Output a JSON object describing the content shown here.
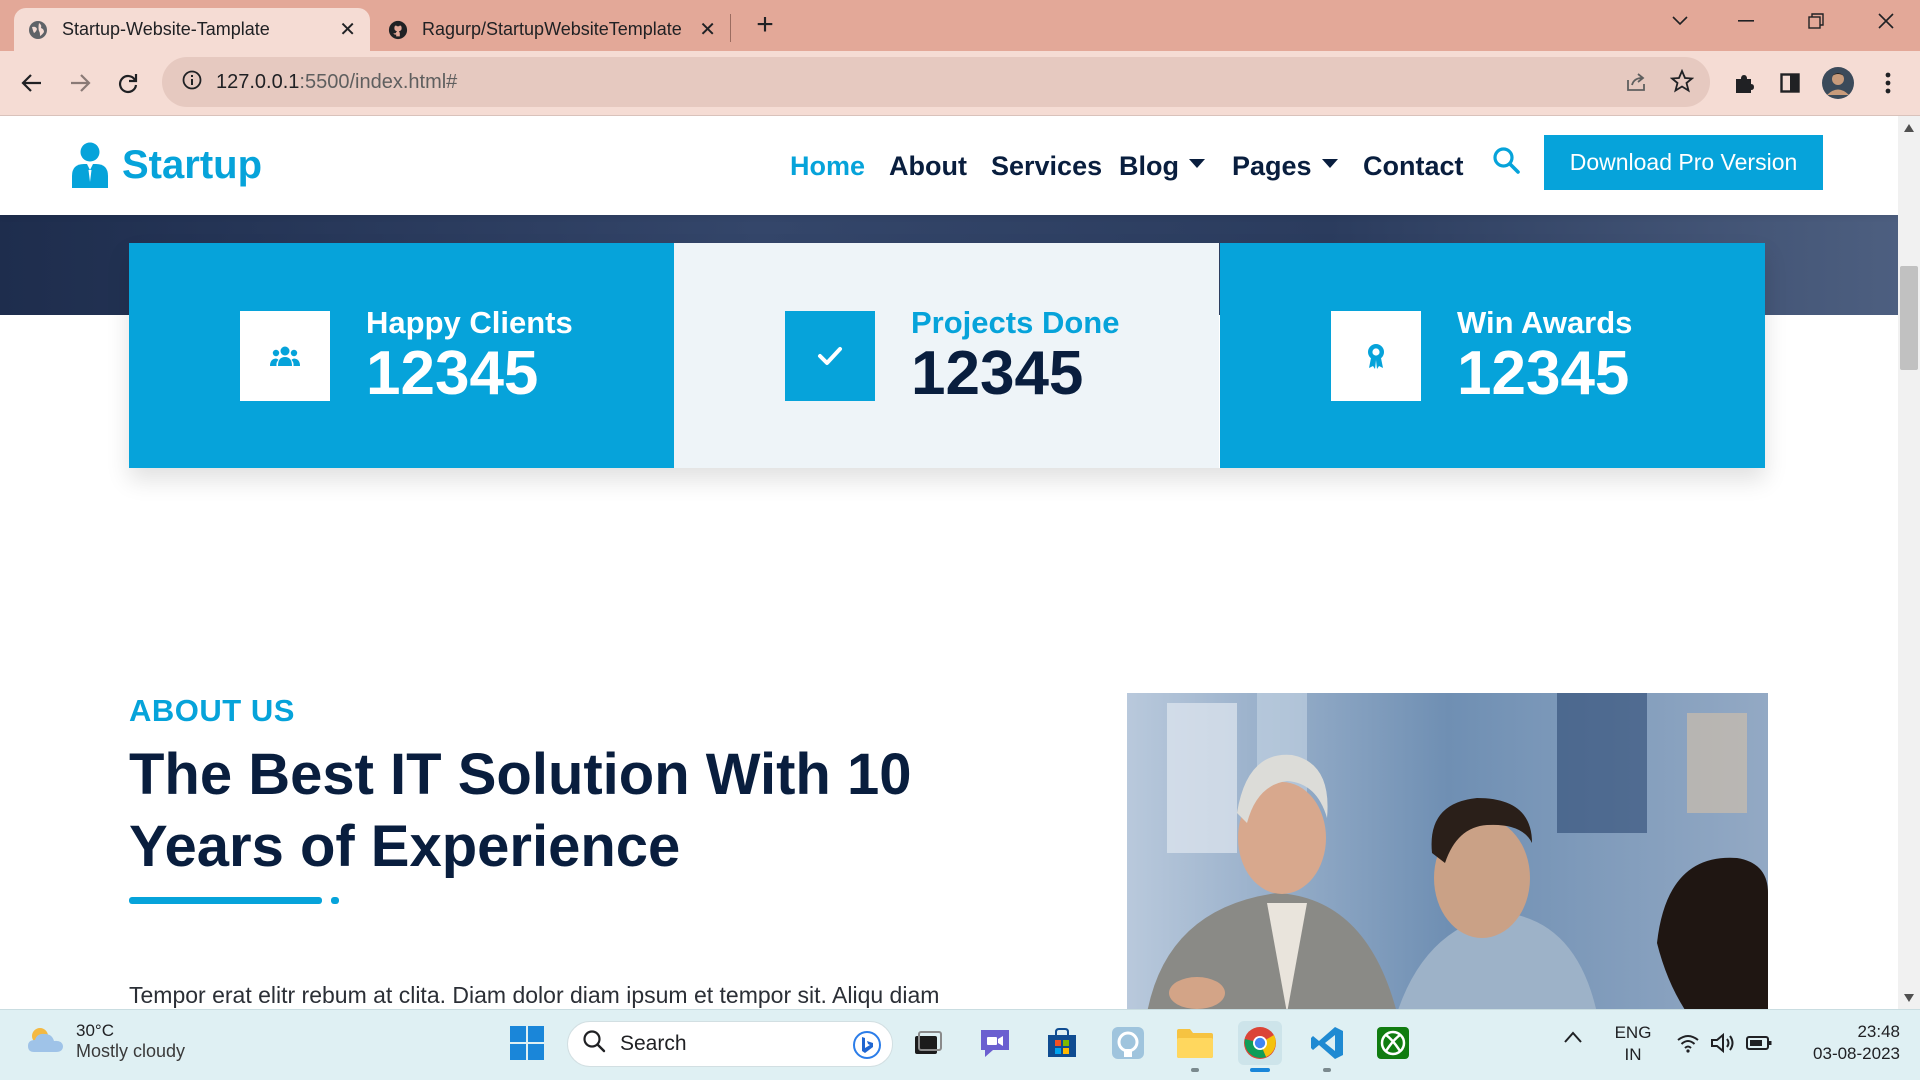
{
  "browser": {
    "tabs": [
      {
        "title": "Startup-Website-Tamplate",
        "active": true,
        "icon": "globe-icon"
      },
      {
        "title": "Ragurp/StartupWebsiteTemplate",
        "active": false,
        "icon": "github-icon"
      }
    ],
    "new_tab": "+",
    "url_host": "127.0.0.1",
    "url_rest": ":5500/index.html#"
  },
  "site": {
    "brand": "Startup",
    "nav": [
      {
        "label": "Home",
        "active": true
      },
      {
        "label": "About"
      },
      {
        "label": "Services"
      },
      {
        "label": "Blog",
        "dropdown": true
      },
      {
        "label": "Pages",
        "dropdown": true
      },
      {
        "label": "Contact"
      }
    ],
    "cta": "Download Pro Version",
    "facts": [
      {
        "label": "Happy Clients",
        "value": "12345",
        "icon": "users-icon"
      },
      {
        "label": "Projects Done",
        "value": "12345",
        "icon": "check-icon"
      },
      {
        "label": "Win Awards",
        "value": "12345",
        "icon": "award-icon"
      }
    ],
    "about": {
      "kicker": "ABOUT US",
      "title": "The Best IT Solution With 10 Years of Experience",
      "body": "Tempor erat elitr rebum at clita. Diam dolor diam ipsum et tempor sit. Aliqu diam"
    },
    "colors": {
      "primary": "#06a3da",
      "dark": "#091e3e"
    }
  },
  "taskbar": {
    "weather_temp": "30°C",
    "weather_desc": "Mostly cloudy",
    "search_placeholder": "Search",
    "lang_1": "ENG",
    "lang_2": "IN",
    "time": "23:48",
    "date": "03-08-2023"
  }
}
